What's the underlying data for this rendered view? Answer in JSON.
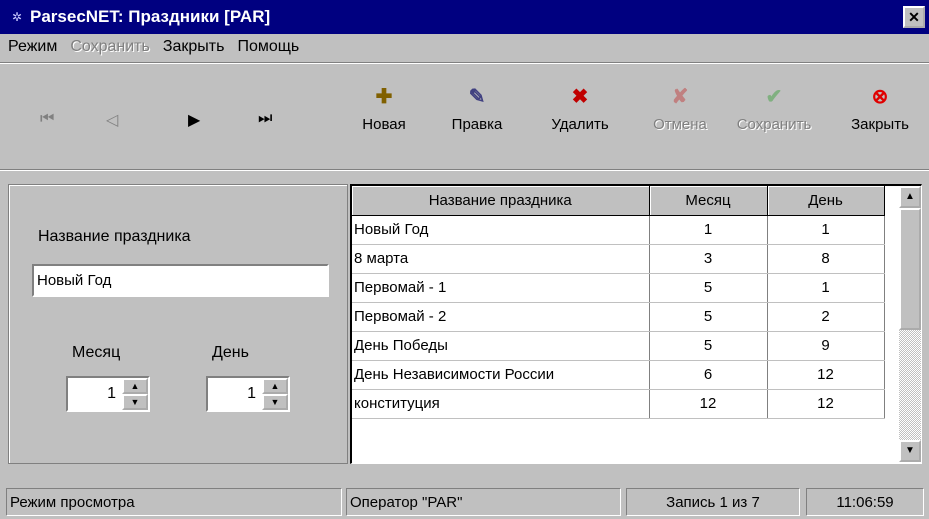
{
  "window": {
    "title": "ParsecNET: Праздники [PAR]"
  },
  "menu": [
    "Режим",
    "Сохранить",
    "Закрыть",
    "Помощь"
  ],
  "menu_disabled": [
    false,
    true,
    false,
    false
  ],
  "toolbar": {
    "nav": [
      "⏮",
      "◁",
      "▶",
      "⏭"
    ],
    "buttons": [
      {
        "label": "Новая",
        "icon": "new-record-icon",
        "glyph": "✚"
      },
      {
        "label": "Правка",
        "icon": "edit-icon",
        "glyph": "✎"
      },
      {
        "label": "Удалить",
        "icon": "delete-icon",
        "glyph": "✖"
      },
      {
        "label": "Отмена",
        "icon": "cancel-icon",
        "glyph": "✘"
      },
      {
        "label": "Сохранить",
        "icon": "save-check-icon",
        "glyph": "✔"
      },
      {
        "label": "Закрыть",
        "icon": "close-circle-icon",
        "glyph": "⊗"
      }
    ]
  },
  "form": {
    "name_label": "Название праздника",
    "name_value": "Новый Год",
    "month_label": "Месяц",
    "day_label": "День",
    "month_value": "1",
    "day_value": "1"
  },
  "grid": {
    "headers": [
      "Название праздника",
      "Месяц",
      "День"
    ],
    "rows": [
      [
        "Новый Год",
        "1",
        "1"
      ],
      [
        "8 марта",
        "3",
        "8"
      ],
      [
        "Первомай - 1",
        "5",
        "1"
      ],
      [
        "Первомай - 2",
        "5",
        "2"
      ],
      [
        "День Победы",
        "5",
        "9"
      ],
      [
        "День Независимости России",
        "6",
        "12"
      ],
      [
        "конституция",
        "12",
        "12"
      ]
    ]
  },
  "status": {
    "mode": "Режим просмотра",
    "operator": "Оператор \"PAR\"",
    "record": "Запись 1 из 7",
    "time": "11:06:59"
  }
}
